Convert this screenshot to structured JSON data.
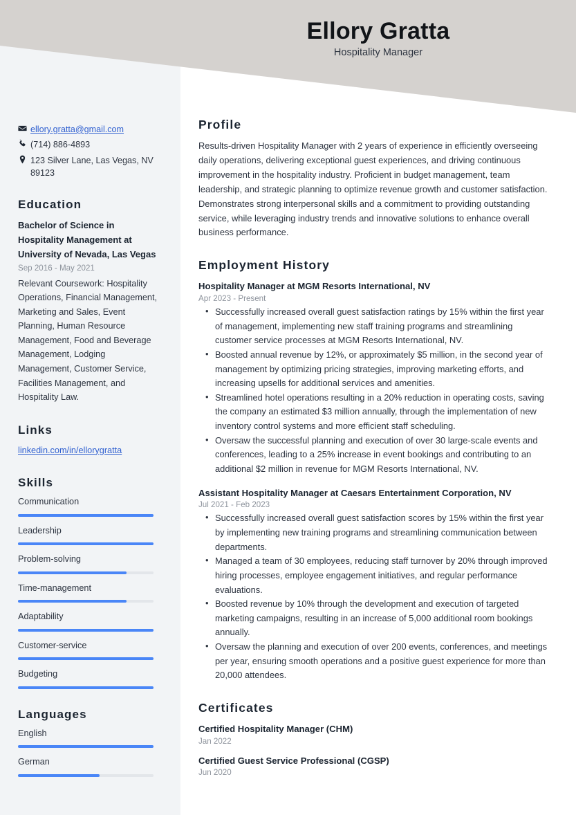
{
  "theme": {
    "header_band_color": "#d5d2cf",
    "sidebar_color": "#f2f4f6",
    "accent_color": "#4a86f7",
    "link_color": "#2f5fd0",
    "heading_color": "#1b2430",
    "body_text_color": "#2d3440",
    "muted_text_color": "#8d939c",
    "bar_track_color": "#e3e6ea"
  },
  "header": {
    "name": "Ellory Gratta",
    "job_title": "Hospitality Manager"
  },
  "sidebar": {
    "contact": [
      {
        "icon": "envelope-icon",
        "text": "ellory.gratta@gmail.com",
        "is_link": true
      },
      {
        "icon": "phone-icon",
        "text": "(714) 886-4893",
        "is_link": false
      },
      {
        "icon": "map-pin-icon",
        "text": "123 Silver Lane, Las Vegas, NV 89123",
        "is_link": false
      }
    ],
    "education": {
      "heading": "Education",
      "entries": [
        {
          "title": "Bachelor of Science in Hospitality Management at University of Nevada, Las Vegas",
          "date": "Sep 2016 - May 2021",
          "description": "Relevant Coursework: Hospitality Operations, Financial Management, Marketing and Sales, Event Planning, Human Resource Management, Food and Beverage Management, Lodging Management, Customer Service, Facilities Management, and Hospitality Law."
        }
      ]
    },
    "links": {
      "heading": "Links",
      "items": [
        {
          "label": "linkedin.com/in/ellorygratta"
        }
      ]
    },
    "skills": {
      "heading": "Skills",
      "items": [
        {
          "label": "Communication",
          "level": 100
        },
        {
          "label": "Leadership",
          "level": 100
        },
        {
          "label": "Problem-solving",
          "level": 80
        },
        {
          "label": "Time-management",
          "level": 80
        },
        {
          "label": "Adaptability",
          "level": 100
        },
        {
          "label": "Customer-service",
          "level": 100
        },
        {
          "label": "Budgeting",
          "level": 100
        }
      ]
    },
    "languages": {
      "heading": "Languages",
      "items": [
        {
          "label": "English",
          "level": 100
        },
        {
          "label": "German",
          "level": 60
        }
      ]
    }
  },
  "main": {
    "profile": {
      "heading": "Profile",
      "text": "Results-driven Hospitality Manager with 2 years of experience in efficiently overseeing daily operations, delivering exceptional guest experiences, and driving continuous improvement in the hospitality industry. Proficient in budget management, team leadership, and strategic planning to optimize revenue growth and customer satisfaction. Demonstrates strong interpersonal skills and a commitment to providing outstanding service, while leveraging industry trends and innovative solutions to enhance overall business performance."
    },
    "employment": {
      "heading": "Employment History",
      "jobs": [
        {
          "title": "Hospitality Manager at MGM Resorts International, NV",
          "date": "Apr 2023 - Present",
          "bullets": [
            "Successfully increased overall guest satisfaction ratings by 15% within the first year of management, implementing new staff training programs and streamlining customer service processes at MGM Resorts International, NV.",
            "Boosted annual revenue by 12%, or approximately $5 million, in the second year of management by optimizing pricing strategies, improving marketing efforts, and increasing upsells for additional services and amenities.",
            "Streamlined hotel operations resulting in a 20% reduction in operating costs, saving the company an estimated $3 million annually, through the implementation of new inventory control systems and more efficient staff scheduling.",
            "Oversaw the successful planning and execution of over 30 large-scale events and conferences, leading to a 25% increase in event bookings and contributing to an additional $2 million in revenue for MGM Resorts International, NV."
          ]
        },
        {
          "title": "Assistant Hospitality Manager at Caesars Entertainment Corporation, NV",
          "date": "Jul 2021 - Feb 2023",
          "bullets": [
            "Successfully increased overall guest satisfaction scores by 15% within the first year by implementing new training programs and streamlining communication between departments.",
            "Managed a team of 30 employees, reducing staff turnover by 20% through improved hiring processes, employee engagement initiatives, and regular performance evaluations.",
            "Boosted revenue by 10% through the development and execution of targeted marketing campaigns, resulting in an increase of 5,000 additional room bookings annually.",
            "Oversaw the planning and execution of over 200 events, conferences, and meetings per year, ensuring smooth operations and a positive guest experience for more than 20,000 attendees."
          ]
        }
      ]
    },
    "certificates": {
      "heading": "Certificates",
      "items": [
        {
          "title": "Certified Hospitality Manager (CHM)",
          "date": "Jan 2022"
        },
        {
          "title": "Certified Guest Service Professional (CGSP)",
          "date": "Jun 2020"
        }
      ]
    }
  }
}
